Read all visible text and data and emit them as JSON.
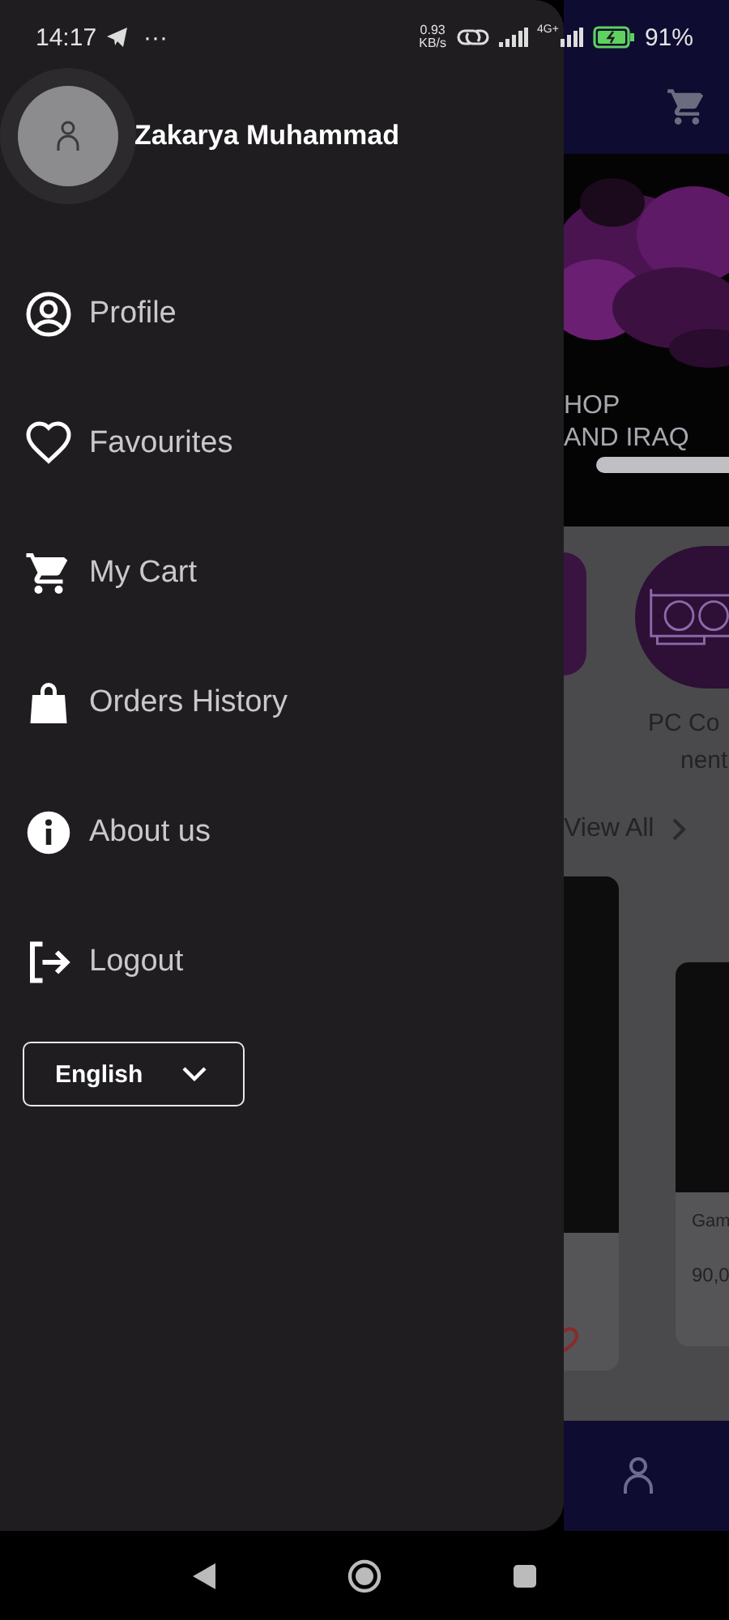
{
  "status_bar": {
    "time": "14:17",
    "more": "···",
    "data_rate": "0.93",
    "data_unit": "KB/s",
    "network": "4G+",
    "battery": "91%"
  },
  "drawer": {
    "user_name": "Zakarya Muhammad",
    "items": [
      {
        "kind": "profile",
        "label": "Profile"
      },
      {
        "kind": "heart",
        "label": "Favourites"
      },
      {
        "kind": "cart",
        "label": "My Cart"
      },
      {
        "kind": "bag",
        "label": "Orders History"
      },
      {
        "kind": "info",
        "label": "About us"
      },
      {
        "kind": "logout",
        "label": "Logout"
      }
    ],
    "language": "English"
  },
  "background": {
    "banner_lines": [
      "HOP",
      "AND IRAQ"
    ],
    "category_label_lines": [
      "PC Co",
      "nent"
    ],
    "view_all": "View All",
    "product": {
      "name": "Gam",
      "price": "90,0"
    }
  }
}
